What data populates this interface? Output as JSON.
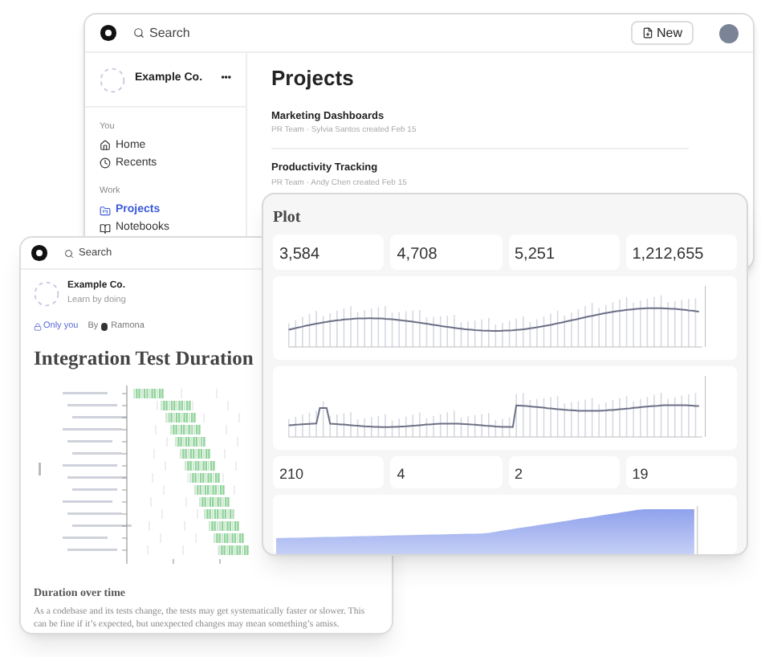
{
  "projects_window": {
    "search_placeholder": "Search",
    "new_button": "New",
    "workspace": "Example Co.",
    "more": "•••",
    "sections": [
      {
        "heading": "You",
        "items": [
          {
            "label": "Home",
            "selected": false
          },
          {
            "label": "Recents",
            "selected": false
          }
        ]
      },
      {
        "heading": "Work",
        "items": [
          {
            "label": "Projects",
            "selected": true
          },
          {
            "label": "Notebooks",
            "selected": false
          }
        ]
      }
    ],
    "title": "Projects",
    "projects": [
      {
        "name": "Marketing Dashboards",
        "meta": "PR Team · Sylvia Santos created Feb 15"
      },
      {
        "name": "Productivity Tracking",
        "meta": "PR Team · Andy Chen created Feb 15"
      }
    ]
  },
  "plot_window": {
    "title": "Plot",
    "stats_top": [
      {
        "value": "3,584"
      },
      {
        "value": "4,708"
      },
      {
        "value": "5,251"
      },
      {
        "value": "1,212,655"
      }
    ],
    "stats_bottom": [
      {
        "value": "210"
      },
      {
        "value": "4"
      },
      {
        "value": "2"
      },
      {
        "value": "19"
      }
    ]
  },
  "notebook_window": {
    "search_placeholder": "Search",
    "workspace": "Example Co.",
    "tagline": "Learn by doing",
    "visibility": "Only you",
    "by": "By",
    "author": "Ramona",
    "title": "Integration Test Duration",
    "section_heading": "Duration over time",
    "paragraph": "As a codebase and its tests change, the tests may get systematically faster or slower. This can be fine if it’s expected, but unexpected changes may mean something’s amiss."
  }
}
